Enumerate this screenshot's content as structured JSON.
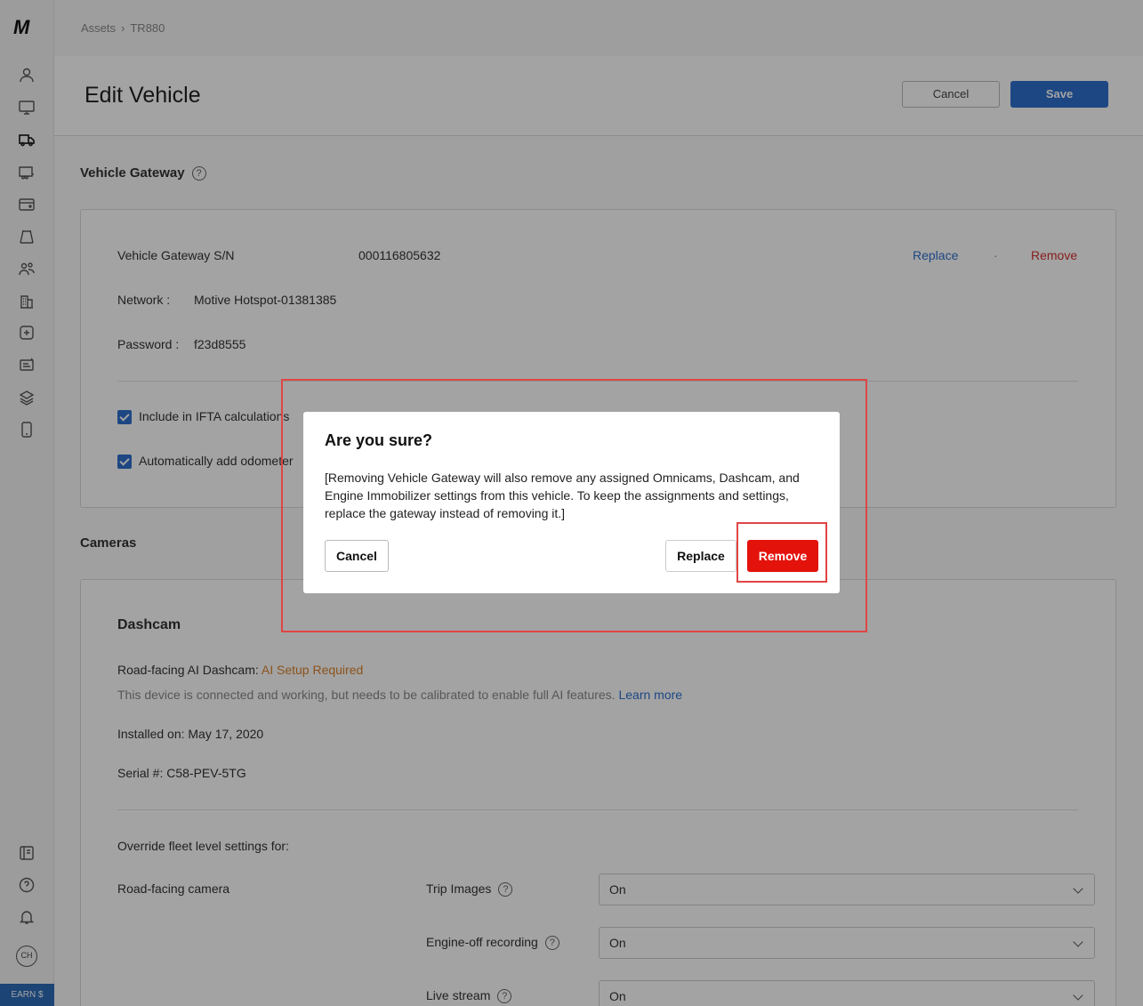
{
  "breadcrumb": {
    "root": "Assets",
    "current": "TR880"
  },
  "header": {
    "title": "Edit Vehicle",
    "cancel_label": "Cancel",
    "save_label": "Save"
  },
  "gateway": {
    "section_title": "Vehicle Gateway",
    "sn_label": "Vehicle Gateway S/N",
    "sn_value": "000116805632",
    "replace_label": "Replace",
    "dot": "·",
    "remove_label": "Remove",
    "network_label": "Network :",
    "network_value": "Motive Hotspot-01381385",
    "password_label": "Password :",
    "password_value": "f23d8555",
    "ifta_label": "Include in IFTA calculations",
    "odometer_label": "Automatically add odometer"
  },
  "cameras": {
    "section_title": "Cameras",
    "dashcam_title": "Dashcam",
    "road_facing_label": "Road-facing AI Dashcam:",
    "road_facing_status": "AI Setup Required",
    "calibration_note": "This device is connected and working, but needs to be calibrated to enable full AI features.",
    "learn_more": "Learn more",
    "installed": "Installed on: May 17, 2020",
    "serial": "Serial #: C58-PEV-5TG",
    "override_label": "Override fleet level settings for:",
    "camera_name": "Road-facing camera",
    "settings": [
      {
        "label": "Trip Images",
        "value": "On"
      },
      {
        "label": "Engine-off recording",
        "value": "On"
      },
      {
        "label": "Live stream",
        "value": "On"
      }
    ]
  },
  "modal": {
    "title": "Are you sure?",
    "body": "[Removing Vehicle Gateway will also remove any assigned Omnicams, Dashcam, and Engine Immobilizer settings from this vehicle. To keep the assignments and settings, replace the gateway instead of removing it.]",
    "cancel_label": "Cancel",
    "replace_label": "Replace",
    "remove_label": "Remove"
  },
  "sidebar": {
    "logo": "M",
    "avatar": "CH",
    "earn_label": "EARN $"
  },
  "colors": {
    "accent": "#2e6fce",
    "danger": "#e3120b",
    "warning": "#d9822b",
    "highlight": "#e04545"
  }
}
